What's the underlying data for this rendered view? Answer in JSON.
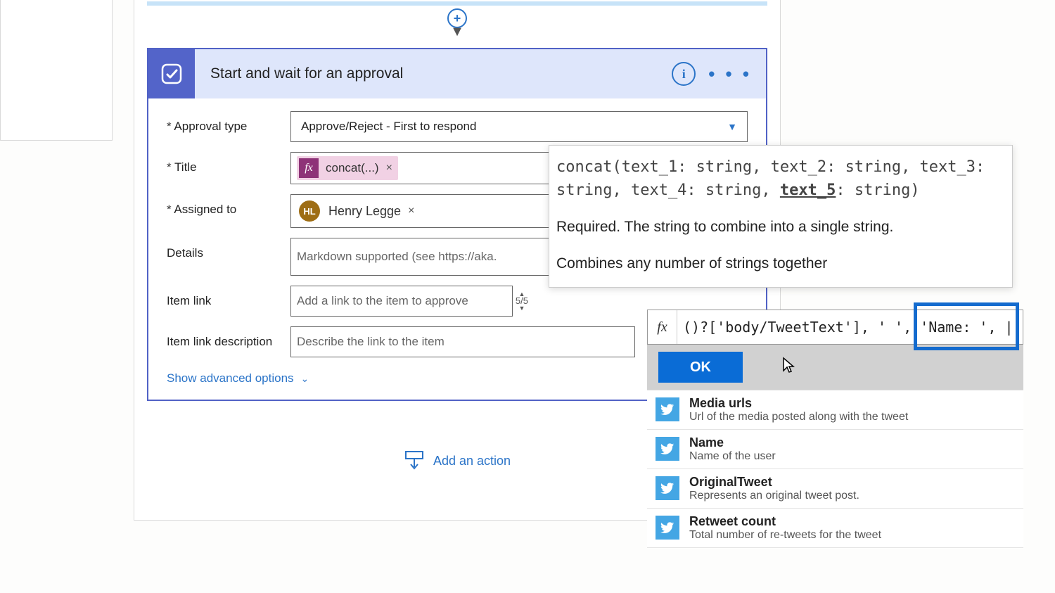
{
  "connector": {
    "plus": "+"
  },
  "card": {
    "title": "Start and wait for an approval",
    "info": "i",
    "dots": "• • •"
  },
  "fields": {
    "approval_type": {
      "label": "Approval type",
      "value": "Approve/Reject - First to respond"
    },
    "title": {
      "label": "Title",
      "token_fx": "fx",
      "token_text": "concat(...)",
      "token_x": "×"
    },
    "assigned_to": {
      "label": "Assigned to",
      "initials": "HL",
      "name": "Henry Legge",
      "x": "×"
    },
    "details": {
      "label": "Details",
      "placeholder": "Markdown supported (see https://aka."
    },
    "item_link": {
      "label": "Item link",
      "placeholder": "Add a link to the item to approve",
      "counter": "5/5"
    },
    "item_link_desc": {
      "label": "Item link description",
      "placeholder": "Describe the link to the item"
    },
    "advanced": "Show advanced options"
  },
  "add_action": "Add an action",
  "tooltip": {
    "sig_pre": "concat(text_1: string, text_2: string, text_3: string, text_4: string, ",
    "sig_ul": "text_5",
    "sig_post": ": string)",
    "req": "Required. The string to combine into a single string.",
    "desc": "Combines any number of strings together"
  },
  "expr": {
    "fx": "fx",
    "text": "()?['body/TweetText'], ' ', 'Name: ', |",
    "ok": "OK"
  },
  "dynamic": [
    {
      "title": "Media urls",
      "desc": "Url of the media posted along with the tweet"
    },
    {
      "title": "Name",
      "desc": "Name of the user"
    },
    {
      "title": "OriginalTweet",
      "desc": "Represents an original tweet post."
    },
    {
      "title": "Retweet count",
      "desc": "Total number of re-tweets for the tweet"
    }
  ]
}
